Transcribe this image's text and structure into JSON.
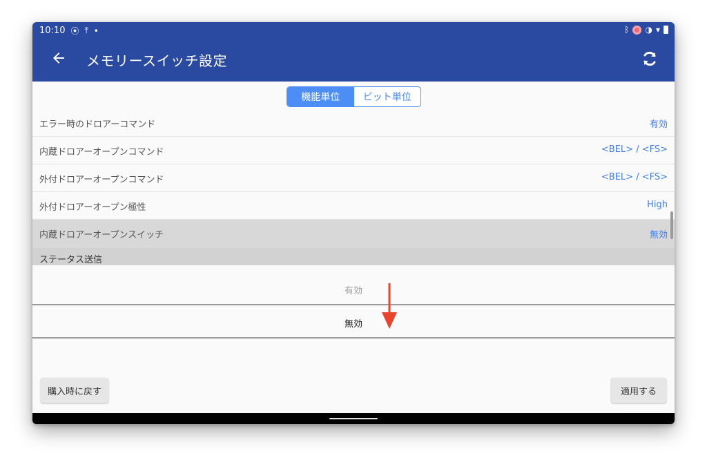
{
  "status_bar": {
    "time": "10:10",
    "left_icons": [
      "location-icon",
      "upload-icon",
      "dot-icon"
    ],
    "right_icons": [
      "bluetooth-icon",
      "record-icon",
      "vibrate-icon",
      "wifi-icon",
      "battery-icon"
    ]
  },
  "app_bar": {
    "title": "メモリースイッチ設定",
    "back_icon": "arrow-back-icon",
    "refresh_icon": "refresh-icon",
    "color": "#2a4aa2"
  },
  "segment": {
    "options": [
      "機能単位",
      "ビット単位"
    ],
    "selected": "機能単位",
    "accent": "#4c8df6"
  },
  "settings": [
    {
      "label": "エラー時のドロアーコマンド",
      "value": "有効"
    },
    {
      "label": "内蔵ドロアーオープンコマンド",
      "value": "<BEL> / <FS>"
    },
    {
      "label": "外付ドロアーオープンコマンド",
      "value": "<BEL> / <FS>"
    },
    {
      "label": "外付ドロアーオープン極性",
      "value": "High"
    },
    {
      "label": "内蔵ドロアーオープンスイッチ",
      "value": "無効"
    }
  ],
  "section": {
    "label": "ステータス送信"
  },
  "picker": {
    "options": [
      "有効",
      "無効"
    ],
    "selected": "無効"
  },
  "buttons": {
    "reset": "購入時に戻す",
    "apply": "適用する"
  },
  "annotation": {
    "arrow_color": "#e8452f"
  }
}
